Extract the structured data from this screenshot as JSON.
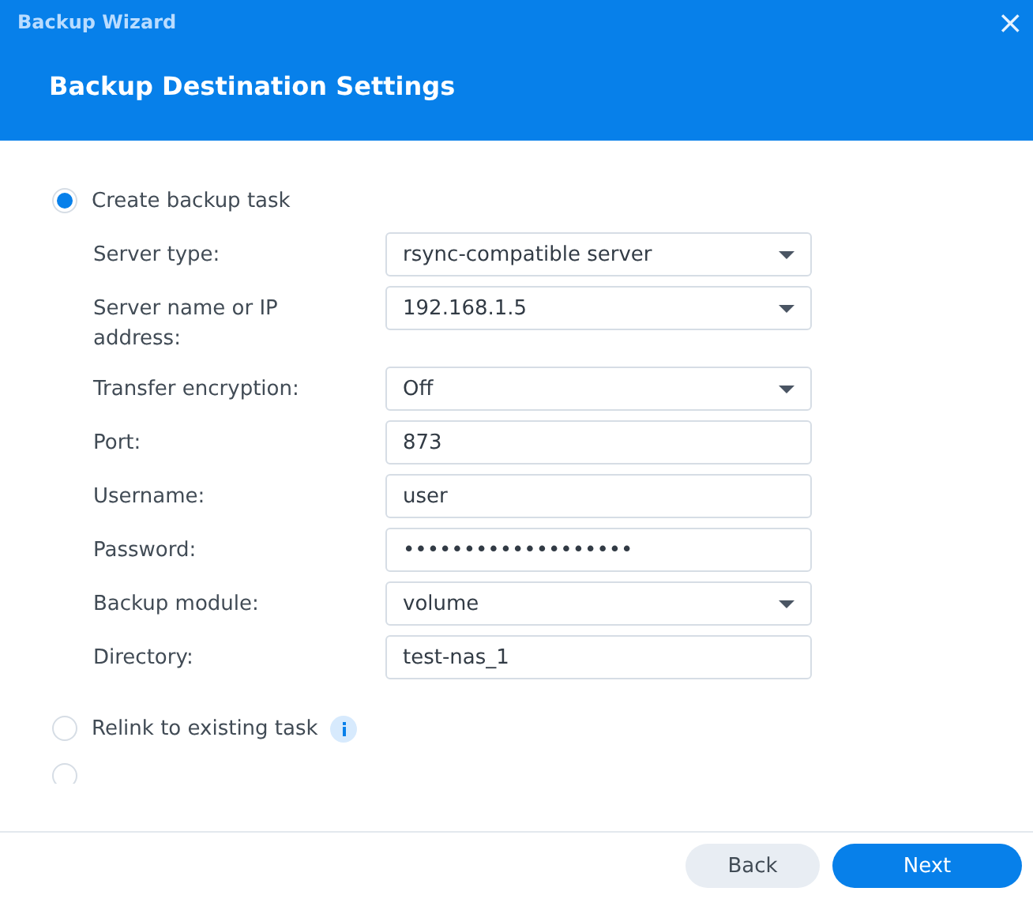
{
  "window": {
    "title": "Backup Wizard",
    "close": "×"
  },
  "heading": "Backup Destination Settings",
  "options": [
    {
      "label": "Create backup task",
      "selected": true,
      "info": false,
      "fields": [
        {
          "label": "Server type:",
          "kind": "select",
          "value": "rsync-compatible server"
        },
        {
          "label": "Server name or IP address:",
          "kind": "select",
          "value": "192.168.1.5"
        },
        {
          "label": "Transfer encryption:",
          "kind": "select",
          "value": "Off"
        },
        {
          "label": "Port:",
          "kind": "text",
          "value": "873"
        },
        {
          "label": "Username:",
          "kind": "text",
          "value": "user"
        },
        {
          "label": "Password:",
          "kind": "text",
          "value": "•••••••••••••••••••"
        },
        {
          "label": "Backup module:",
          "kind": "select",
          "value": "volume"
        },
        {
          "label": "Directory:",
          "kind": "text",
          "value": "test-nas_1"
        }
      ]
    },
    {
      "label": "Relink to existing task",
      "selected": false,
      "info": true
    },
    {
      "selected": false,
      "info": false
    }
  ],
  "buttons": [
    {
      "label": "Back",
      "kind": "secondary"
    },
    {
      "label": "Next",
      "kind": "primary"
    }
  ]
}
